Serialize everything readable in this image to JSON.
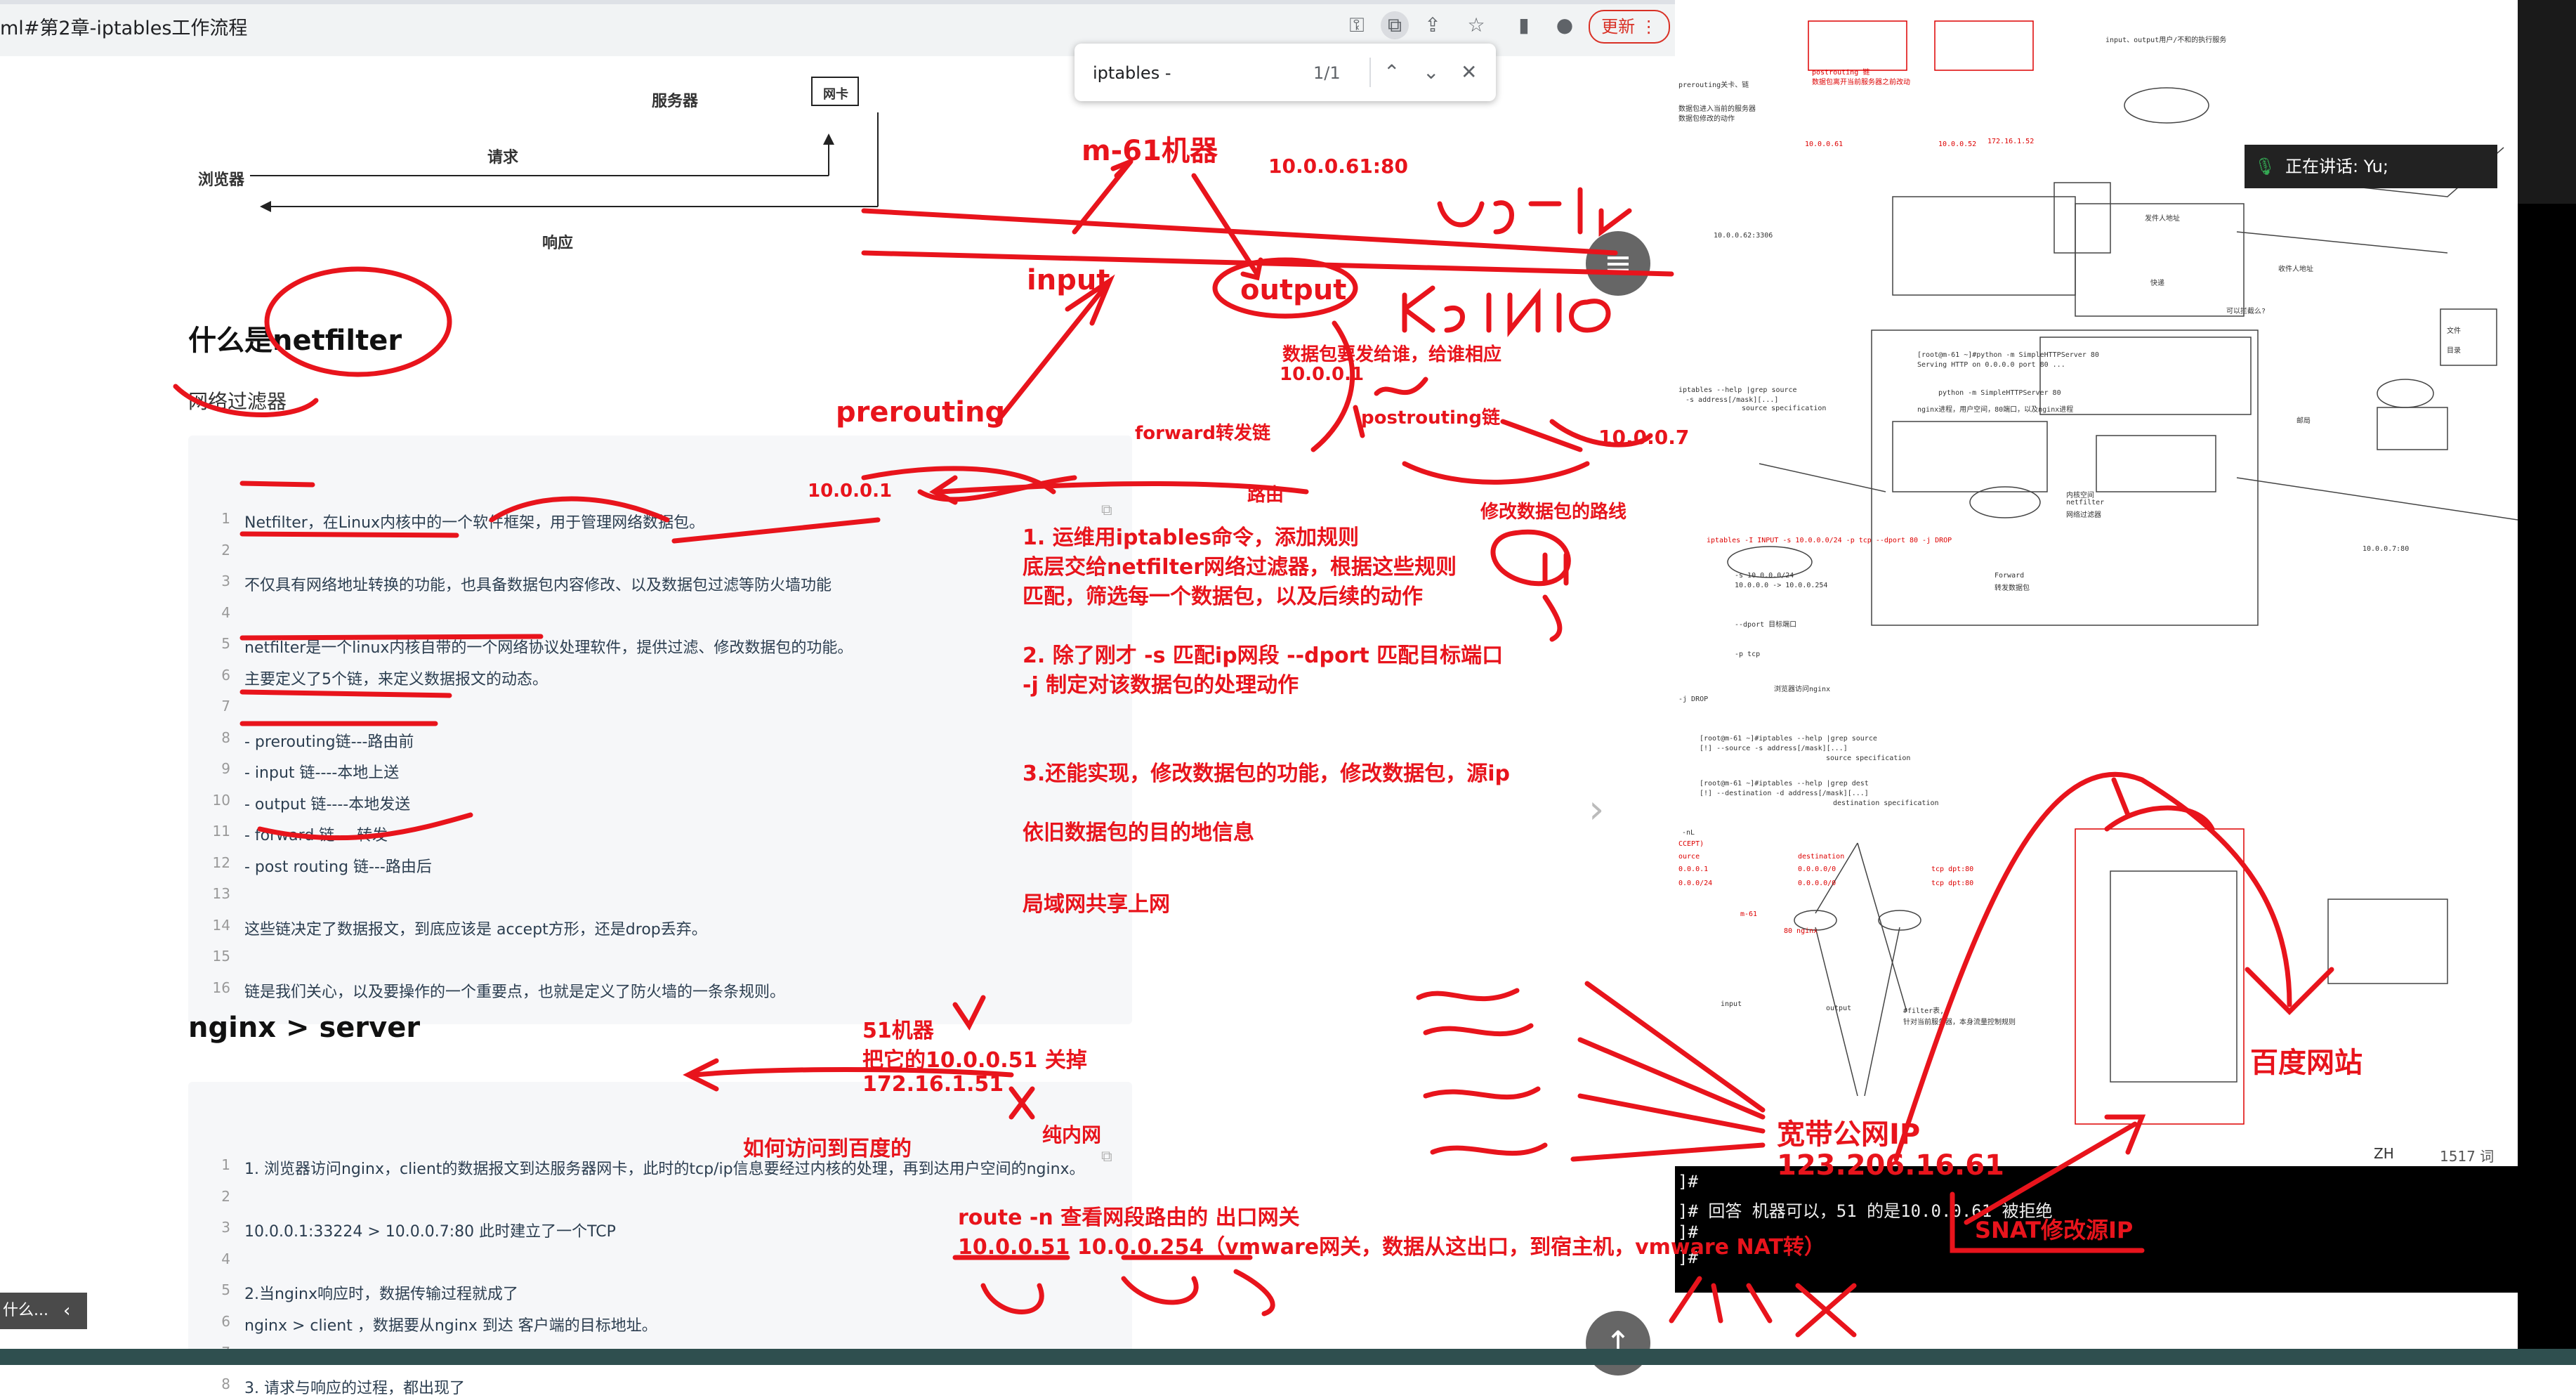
{
  "browser": {
    "url_text": "ml#第2章-iptables工作流程",
    "update_label": "更新",
    "icons": [
      "key-icon",
      "translate-icon",
      "share-icon",
      "star-icon",
      "sidebar-icon",
      "profile-icon",
      "menu-dots-icon"
    ]
  },
  "findbar": {
    "query": "iptables -",
    "count": "1/1"
  },
  "diagram_top": {
    "server": "服务器",
    "nic": "网卡",
    "browser": "浏览器",
    "request": "请求",
    "response": "响应"
  },
  "sec1": {
    "title": "什么是netfilter",
    "subtitle": "网络过滤器"
  },
  "code1": [
    {
      "n": "1",
      "t": "Netfilter，在Linux内核中的一个软件框架，用于管理网络数据包。"
    },
    {
      "n": "2",
      "t": ""
    },
    {
      "n": "3",
      "t": "不仅具有网络地址转换的功能，也具备数据包内容修改、以及数据包过滤等防火墙功能"
    },
    {
      "n": "4",
      "t": ""
    },
    {
      "n": "5",
      "t": "netfilter是一个linux内核自带的一个网络协议处理软件，提供过滤、修改数据包的功能。"
    },
    {
      "n": "6",
      "t": "主要定义了5个链，来定义数据报文的动态。"
    },
    {
      "n": "7",
      "t": ""
    },
    {
      "n": "8",
      "t": "- prerouting链---路由前"
    },
    {
      "n": "9",
      "t": "- input 链----本地上送"
    },
    {
      "n": "10",
      "t": "- output 链----本地发送"
    },
    {
      "n": "11",
      "t": "- forward 链----转发"
    },
    {
      "n": "12",
      "t": "- post routing 链---路由后"
    },
    {
      "n": "13",
      "t": ""
    },
    {
      "n": "14",
      "t": "这些链决定了数据报文，到底应该是 accept方形，还是drop丢弃。"
    },
    {
      "n": "15",
      "t": ""
    },
    {
      "n": "16",
      "t": "链是我们关心，以及要操作的一个重要点，也就是定义了防火墙的一条条规则。"
    }
  ],
  "sec2": {
    "title": "nginx > server"
  },
  "code2": [
    {
      "n": "1",
      "t": "1. 浏览器访问nginx，client的数据报文到达服务器网卡，此时的tcp/ip信息要经过内核的处理，再到达用户空间的nginx。"
    },
    {
      "n": "2",
      "t": ""
    },
    {
      "n": "3",
      "t": "10.0.0.1:33224 > 10.0.0.7:80 此时建立了一个TCP"
    },
    {
      "n": "4",
      "t": ""
    },
    {
      "n": "5",
      "t": "2.当nginx响应时，数据传输过程就成了"
    },
    {
      "n": "6",
      "t": "nginx > client ，数据要从nginx 到达 客户端的目标地址。"
    },
    {
      "n": "7",
      "t": ""
    },
    {
      "n": "8",
      "t": "3. 请求与响应的过程，都出现了"
    }
  ],
  "side_toc": {
    "label": "什么..."
  },
  "annotations": {
    "machine": "m-61机器",
    "ip61": "10.0.0.61:80",
    "input": "input",
    "output": "output",
    "prerouting": "prerouting",
    "output_note": "数据包要发给谁，给谁相应",
    "ip01a": "10.0.0.1",
    "postrouting": "postrouting链",
    "ip07": "10.0.0.7",
    "forward": "forward转发链",
    "ip01b": "10.0.0.1",
    "routing": "路由",
    "modify_route": "修改数据包的路线",
    "note1a": "1. 运维用iptables命令，添加规则",
    "note1b": "底层交给netfilter网络过滤器，根据这些规则",
    "note1c": "匹配，筛选每一个数据包，以及后续的动作",
    "note2a": "2. 除了刚才 -s 匹配ip网段  --dport 匹配目标端口",
    "note2b": "-j  制定对该数据包的处理动作",
    "note3": "3.还能实现，修改数据包的功能，修改数据包，源ip",
    "note4": "依旧数据包的目的地信息",
    "note5": "局域网共享上网",
    "m51a": "51机器",
    "m51b": "把它的10.0.0.51 关掉",
    "m51c": "172.16.1.51",
    "intranet": "纯内网",
    "baidu_q": "如何访问到百度的",
    "route1": "route -n 查看网段路由的 出口网关",
    "route2": "10.0.0.51     10.0.0.254（vmware网关，数据从这出口，到宿主机，vmware NAT转）",
    "baidu": "百度网站",
    "public1": "宽带公网IP",
    "public2": "123.206.16.61",
    "snat": "SNAT修改源IP",
    "handwritten1": "user",
    "handwritten2": "kernel"
  },
  "right_pane": {
    "speaking": "正在讲话: Yu;",
    "status_lang": "ZH",
    "status_words": "1517 词",
    "mini_texts": {
      "a1": "postrouting 链",
      "a2": "数据包离开当前服务器之前改动",
      "a3": "prerouting关卡、链",
      "a4": "数据包进入当前的服务器",
      "a5": "数据包修改的动作",
      "a6": "input、output用户/不和的执行服务",
      "a7": "10.0.0.61",
      "a8": "10.0.0.52",
      "a9": "172.16.1.52",
      "a10": "10.0.0.62:3306",
      "a11": "[root@m-61 ~]#python -m SimpleHTTPServer 80",
      "a12": "Serving HTTP on 0.0.0.0 port 80 ...",
      "a13": "python -m SimpleHTTPServer 80",
      "a14": "nginx进程，用户空间，80端口，以及nginx进程",
      "a15": "iptables --help |grep source",
      "a16": "-s address[/mask][...]",
      "a17": "source specification",
      "a18": "iptables -I INPUT -s 10.0.0.0/24 -p tcp --dport 80 -j DROP",
      "a19": "-s  10.0.0.0/24",
      "a20": "10.0.0.0 -> 10.0.0.254",
      "a21": "--dport  目标端口",
      "a22": "-p  tcp",
      "a23": "-j DROP",
      "a24": "[root@m-61 ~]#iptables --help |grep source",
      "a25": "[!] --source     -s address[/mask][...]",
      "a26": "source specification",
      "a27": "[root@m-61 ~]#iptables --help |grep dest",
      "a28": "[!] --destination -d address[/mask][...]",
      "a29": "destination specification",
      "a30": "-nL",
      "a31": "CCEPT)",
      "a32": "ource",
      "a33": "destination",
      "a34": "0.0.0.1",
      "a35": "0.0.0.0/0",
      "a36": "tcp dpt:80",
      "a37": "0.0.0/24",
      "a38": "0.0.0.0/0",
      "a39": "tcp dpt:80",
      "a40": "m-61",
      "a41": "80 nginx",
      "a42": "input",
      "a43": "output",
      "a44": "#filter表,",
      "a45": "针对当前服务器，本身流量控制规则",
      "a46": "Forward",
      "a47": "转发数据包",
      "a48": "10.0.0.7:80",
      "a49": "内核空间",
      "a50": "netfilter",
      "a51": "网络过滤器",
      "a52": "浏览器访问nginx",
      "a53": "可以拦截么?",
      "a54": "文件",
      "a55": "目录",
      "a56": "发件人地址",
      "a57": "收件人地址",
      "a58": "快递",
      "a59": "邮局"
    },
    "terminal": [
      "]#",
      "]# 回答  机器可以，51          的是10.0.0.61 被拒绝",
      "]#",
      "]#"
    ]
  },
  "colors": {
    "annotation_red": "#e8141c",
    "chrome_bg": "#f1f3f4",
    "code_bg": "#f6f7f9"
  }
}
